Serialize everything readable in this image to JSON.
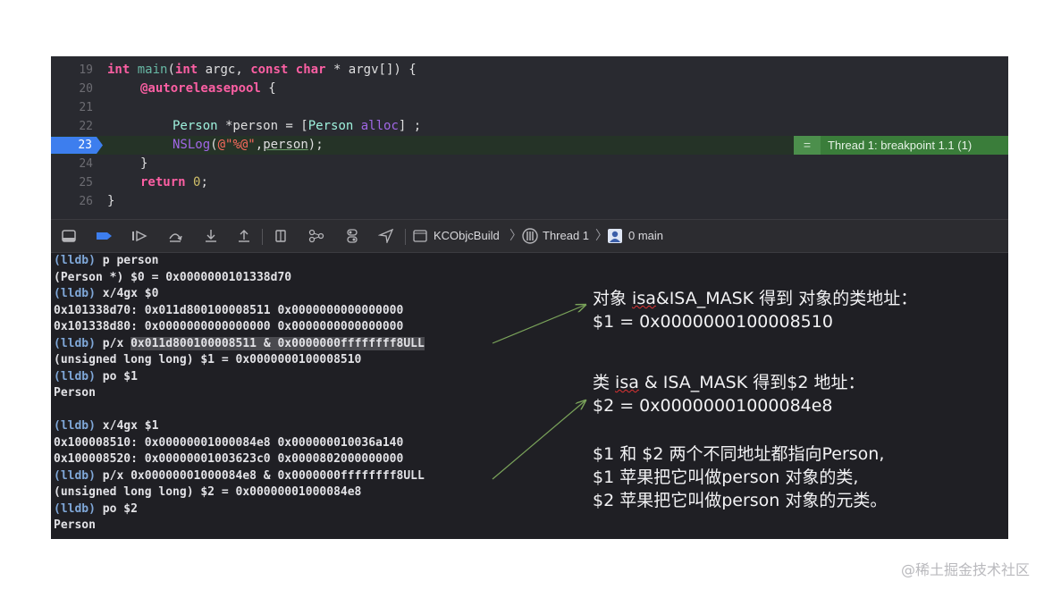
{
  "editor": {
    "lines": [
      {
        "num": "19"
      },
      {
        "num": "20"
      },
      {
        "num": "21"
      },
      {
        "num": "22"
      },
      {
        "num": "23"
      },
      {
        "num": "24"
      },
      {
        "num": "25"
      },
      {
        "num": "26"
      }
    ],
    "code": {
      "l19_int": "int",
      "l19_main": "main",
      "l19_paren": "(",
      "l19_int2": "int",
      "l19_argc": " argc, ",
      "l19_const": "const",
      "l19_char": "char",
      "l19_rest": " * argv[]) {",
      "l20_pool": "@autoreleasepool",
      "l20_brace": " {",
      "l22_person": "Person",
      "l22_var": " *person = [",
      "l22_person2": "Person",
      "l22_alloc": "alloc",
      "l22_end": "] ;",
      "l23_nslog": "NSLog",
      "l23_open": "(",
      "l23_str": "@\"%@\"",
      "l23_comma": ",",
      "l23_var": "person",
      "l23_end": ");",
      "l24": "}",
      "l25_return": "return",
      "l25_zero": "0",
      "l25_semi": ";",
      "l26": "}"
    },
    "breakpoint_badge": {
      "icon": "=",
      "text": "Thread 1: breakpoint 1.1 (1)"
    }
  },
  "debugbar": {
    "target": "KCObjcBuild",
    "thread": "Thread 1",
    "frame": "0 main"
  },
  "console": {
    "lines": [
      {
        "prompt": "(lldb)",
        "text": " p person"
      },
      {
        "prompt": "",
        "text": "(Person *) $0 = 0x0000000101338d70"
      },
      {
        "prompt": "(lldb)",
        "text": " x/4gx $0"
      },
      {
        "prompt": "",
        "text": "0x101338d70: 0x011d800100008511 0x0000000000000000"
      },
      {
        "prompt": "",
        "text": "0x101338d80: 0x0000000000000000 0x0000000000000000"
      },
      {
        "prompt": "(lldb)",
        "text": " p/x ",
        "hl": "0x011d800100008511 & 0x0000000ffffffff8ULL"
      },
      {
        "prompt": "",
        "text": "(unsigned long long) $1 = 0x0000000100008510"
      },
      {
        "prompt": "(lldb)",
        "text": " po $1"
      },
      {
        "prompt": "",
        "text": "Person"
      },
      {
        "prompt": "",
        "text": ""
      },
      {
        "prompt": "(lldb)",
        "text": " x/4gx $1"
      },
      {
        "prompt": "",
        "text": "0x100008510: 0x00000001000084e8 0x000000010036a140"
      },
      {
        "prompt": "",
        "text": "0x100008520: 0x00000001003623c0 0x0000802000000000"
      },
      {
        "prompt": "(lldb)",
        "text": " p/x 0x00000001000084e8 & 0x0000000ffffffff8ULL"
      },
      {
        "prompt": "",
        "text": "(unsigned long long) $2 = 0x00000001000084e8"
      },
      {
        "prompt": "(lldb)",
        "text": " po $2"
      },
      {
        "prompt": "",
        "text": "Person"
      }
    ]
  },
  "notes": {
    "n1_pre": "对象 ",
    "n1_isa": "isa",
    "n1_post": "&ISA_MASK 得到 对象的类地址：",
    "n2": "$1 = 0x0000000100008510",
    "n3_pre": "类 ",
    "n3_isa": "isa",
    "n3_post": " & ISA_MASK 得到$2 地址：",
    "n4": "$2 = 0x00000001000084e8",
    "n5": "$1 和 $2 两个不同地址都指向Person,",
    "n6": "$1 苹果把它叫做person 对象的类,",
    "n7": "$2 苹果把它叫做person 对象的元类。"
  },
  "watermark": "@稀土掘金技术社区",
  "colors": {
    "accent_current_line": "#3d7eee",
    "breakpoint_green": "#3a7d3a",
    "arrow": "#7aa35a"
  }
}
